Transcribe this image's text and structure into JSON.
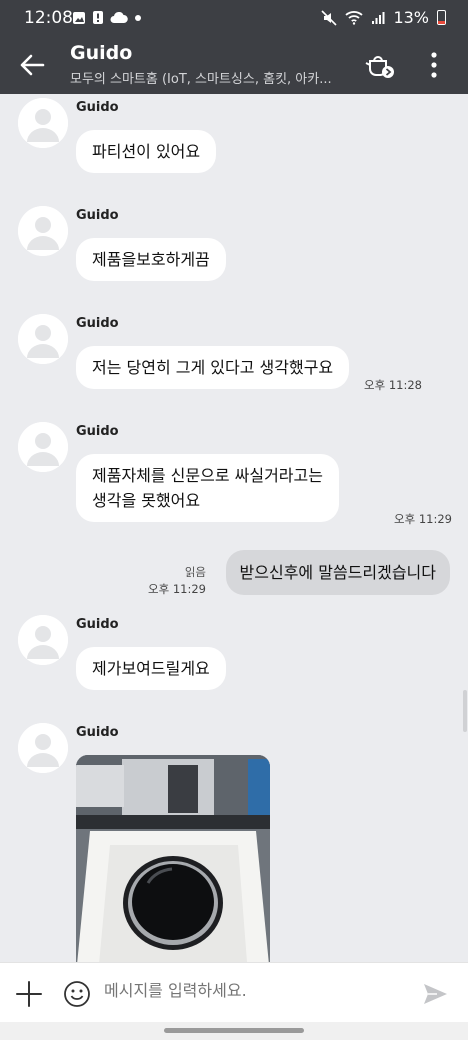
{
  "status_bar": {
    "time": "12:08",
    "battery": "13%"
  },
  "header": {
    "title": "Guido",
    "subtitle": "모두의 스마트홈 (IoT, 스마트싱스, 홈킷, 아카..."
  },
  "messages": [
    {
      "sender": "Guido",
      "text": "파티션이 있어요"
    },
    {
      "sender": "Guido",
      "text": "제품을보호하게끔"
    },
    {
      "sender": "Guido",
      "text": "저는 당연히 그게 있다고 생각했구요",
      "time": "오후 11:28"
    },
    {
      "sender": "Guido",
      "line1": "제품자체를 신문으로 싸실거라고는",
      "line2": "생각을 못했어요",
      "time": "오후 11:29"
    },
    {
      "text": "받으신후에 말씀드리겠습니다",
      "read": "읽음",
      "time": "오후 11:29"
    },
    {
      "sender": "Guido",
      "text": "제가보여드릴게요"
    },
    {
      "sender": "Guido"
    }
  ],
  "input": {
    "placeholder": "메시지를 입력하세요."
  },
  "colors": {
    "header_bg": "#3d3f44",
    "chat_bg": "#ebecef",
    "my_bubble": "#d6d7da"
  }
}
